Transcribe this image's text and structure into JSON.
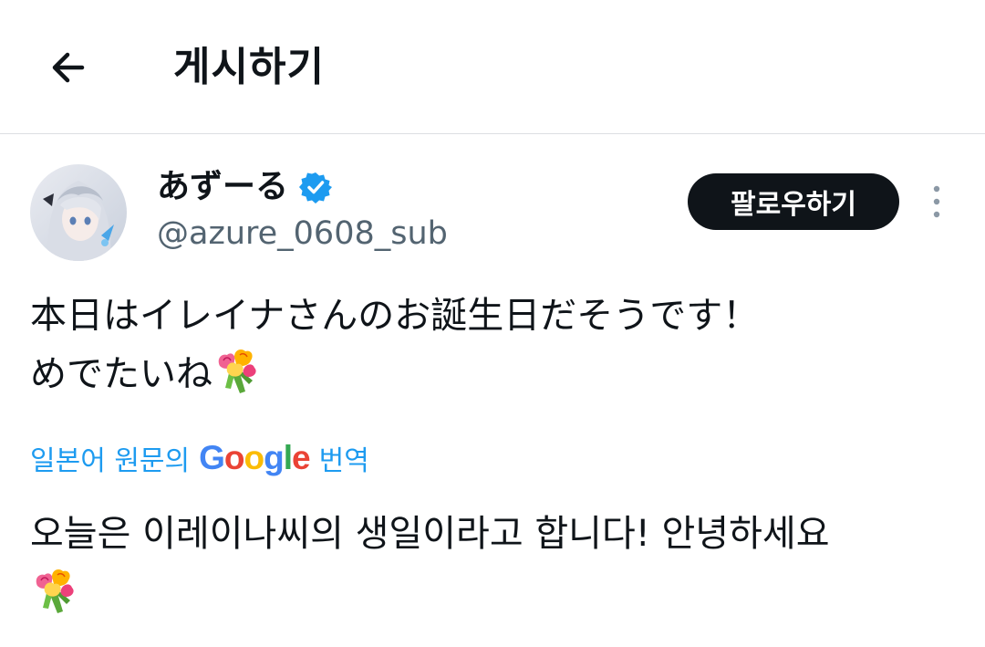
{
  "header": {
    "back_icon": "arrow-left-icon",
    "title": "게시하기"
  },
  "author": {
    "display_name": "あずーる",
    "verified_icon": "verified-badge-icon",
    "handle": "@azure_0608_sub",
    "follow_label": "팔로우하기",
    "more_icon": "more-vertical-icon"
  },
  "tweet": {
    "line1": "本日はイレイナさんのお誕生日だそうです！",
    "line2": "めでたいね",
    "emoji_icon": "bouquet-icon"
  },
  "translation": {
    "prefix": "일본어 원문의",
    "brand_letters": [
      "G",
      "o",
      "o",
      "g",
      "l",
      "e"
    ],
    "suffix": "번역",
    "text": "오늘은 이레이나씨의 생일이라고 합니다! 안녕하세요"
  },
  "colors": {
    "accent": "#1d9bf0",
    "text_primary": "#0f1419",
    "text_secondary": "#536471",
    "google_blue": "#4285f4",
    "google_red": "#ea4335",
    "google_yellow": "#fbbc05",
    "google_green": "#34a853"
  }
}
